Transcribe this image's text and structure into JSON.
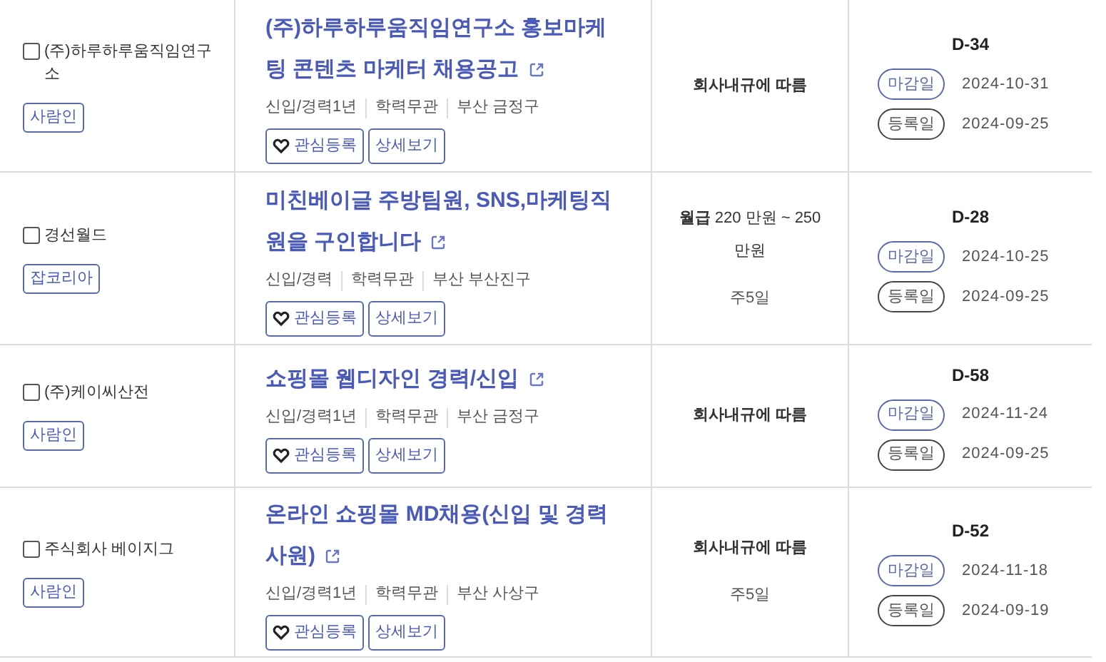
{
  "rows": [
    {
      "company": "(주)하루하루움직임연구소",
      "checked": false,
      "source": "사람인",
      "title": "(주)하루하루움직임연구소 홍보마케팅 콘텐츠 마케터 채용공고",
      "meta": [
        "신입/경력1년",
        "학력무관",
        "부산 금정구"
      ],
      "interest": "관심등록",
      "detail": "상세보기",
      "salary": [
        "회사내규에 따름"
      ],
      "dday": "D-34",
      "deadline_label": "마감일",
      "deadline": "2024-10-31",
      "posted_label": "등록일",
      "posted": "2024-09-25"
    },
    {
      "company": "경선월드",
      "checked": false,
      "source": "잡코리아",
      "title": "미친베이글 주방팀원, SNS,마케팅직원을 구인합니다",
      "meta": [
        "신입/경력",
        "학력무관",
        "부산 부산진구"
      ],
      "interest": "관심등록",
      "detail": "상세보기",
      "salary": [
        "**월급** 220 만원 ~ 250 만원",
        "주5일"
      ],
      "dday": "D-28",
      "deadline_label": "마감일",
      "deadline": "2024-10-25",
      "posted_label": "등록일",
      "posted": "2024-09-25"
    },
    {
      "company": "(주)케이씨산전",
      "checked": false,
      "source": "사람인",
      "title": "쇼핑몰 웹디자인 경력/신입",
      "meta": [
        "신입/경력1년",
        "학력무관",
        "부산 금정구"
      ],
      "interest": "관심등록",
      "detail": "상세보기",
      "salary": [
        "회사내규에 따름"
      ],
      "dday": "D-58",
      "deadline_label": "마감일",
      "deadline": "2024-11-24",
      "posted_label": "등록일",
      "posted": "2024-09-25"
    },
    {
      "company": "주식회사 베이지그",
      "checked": false,
      "source": "사람인",
      "title": "온라인 쇼핑몰 MD채용(신입 및 경력 사원)",
      "meta": [
        "신입/경력1년",
        "학력무관",
        "부산 사상구"
      ],
      "interest": "관심등록",
      "detail": "상세보기",
      "salary": [
        "회사내규에 따름",
        "주5일"
      ],
      "dday": "D-52",
      "deadline_label": "마감일",
      "deadline": "2024-11-18",
      "posted_label": "등록일",
      "posted": "2024-09-19"
    }
  ]
}
